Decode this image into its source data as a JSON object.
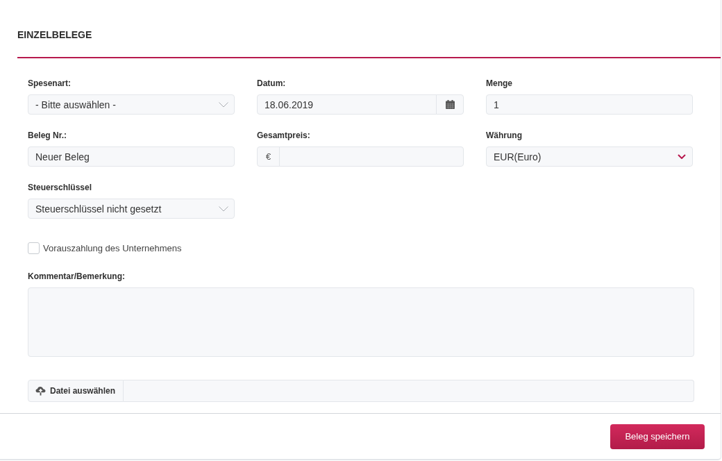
{
  "title": "EINZELBELEGE",
  "fields": [
    {
      "kind": "select",
      "label": "Spesenart:",
      "value": "- Bitte auswählen -",
      "highlighted": false
    },
    {
      "kind": "date",
      "label": "Datum:",
      "value": "18.06.2019"
    },
    {
      "kind": "text",
      "label": "Menge",
      "value": "1"
    },
    {
      "kind": "text",
      "label": "Beleg Nr.:",
      "value": "Neuer Beleg"
    },
    {
      "kind": "currency",
      "label": "Gesamtpreis:",
      "prefix": "€"
    },
    {
      "kind": "select",
      "label": "Währung",
      "value": "EUR(Euro)",
      "highlighted": true
    },
    {
      "kind": "select",
      "label": "Steuerschlüssel",
      "value": "Steuerschlüssel nicht gesetzt",
      "highlighted": false
    }
  ],
  "checkbox": {
    "label": "Vorauszahlung des Unternehmens",
    "checked": false
  },
  "comment": {
    "label": "Kommentar/Bemerkung:"
  },
  "upload": {
    "button": "Datei auswählen"
  },
  "footer": {
    "button": "Beleg speichern"
  }
}
